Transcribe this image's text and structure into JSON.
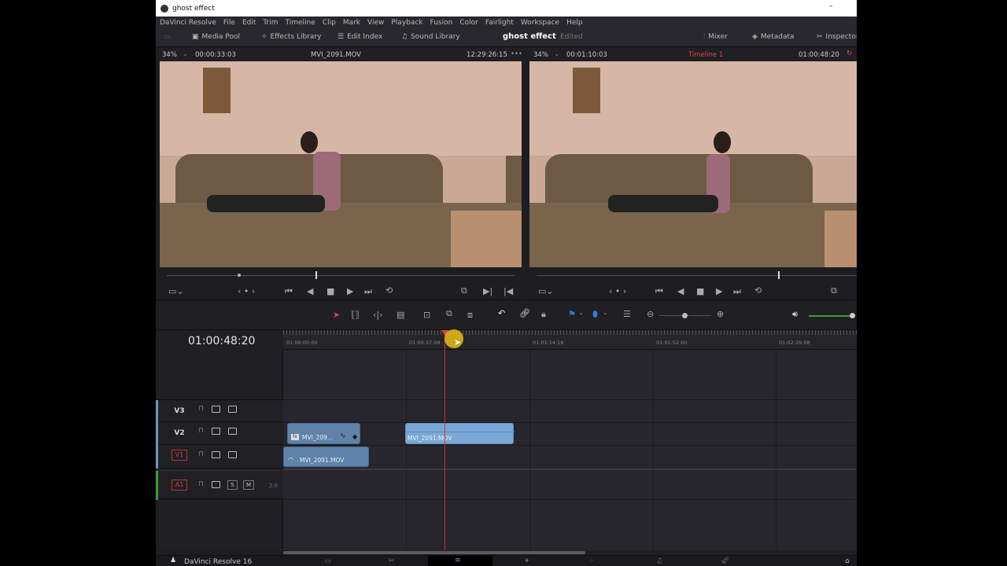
{
  "window": {
    "title": "ghost effect"
  },
  "menu": [
    "DaVinci Resolve",
    "File",
    "Edit",
    "Trim",
    "Timeline",
    "Clip",
    "Mark",
    "View",
    "Playback",
    "Fusion",
    "Color",
    "Fairlight",
    "Workspace",
    "Help"
  ],
  "toolbar": {
    "media_pool": "Media Pool",
    "effects_library": "Effects Library",
    "edit_index": "Edit Index",
    "sound_library": "Sound Library",
    "project_name": "ghost effect",
    "project_status": "Edited",
    "mixer": "Mixer",
    "metadata": "Metadata",
    "inspector": "Inspector"
  },
  "source_viewer": {
    "zoom": "34%",
    "duration": "00:00:33:03",
    "clip": "MVI_2091.MOV",
    "timecode": "12:29:26:15",
    "more": "•••"
  },
  "timeline_viewer": {
    "zoom": "34%",
    "duration": "00:01:10:03",
    "timeline": "Timeline 1",
    "timecode": "01:00:48:20"
  },
  "timeline": {
    "current_timecode": "01:00:48:20",
    "ruler": [
      "01:00:00:00",
      "01:00:37:08",
      "01:01:14:16",
      "01:01:52:00",
      "01:02:29:08"
    ],
    "tracks": [
      {
        "name": "V3"
      },
      {
        "name": "V2"
      },
      {
        "name": "V1"
      },
      {
        "name": "A1",
        "channels": "2.0",
        "solo": "S",
        "mute": "M"
      }
    ],
    "clips": {
      "v2_a": "MVI_209...",
      "v2_b": "MVI_2091.MOV",
      "v1": "MVI_2091.MOV"
    }
  },
  "bottom": {
    "app": "DaVinci Resolve 16"
  },
  "colors": {
    "accent_red": "#e0443c",
    "clip_blue": "#6d93bd",
    "clip_selected": "#7aa8d6",
    "audio_green": "#3c9b3c"
  }
}
